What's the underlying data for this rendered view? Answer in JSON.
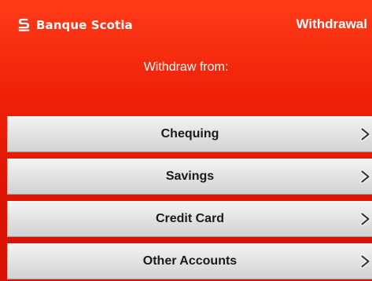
{
  "brand": {
    "name": "Banque Scotia",
    "logo_icon": "scotia-s-logo-icon"
  },
  "screen": {
    "title": "Withdrawal",
    "prompt": "Withdraw from:"
  },
  "options": [
    {
      "label": "Chequing",
      "icon": "chevron-right-icon"
    },
    {
      "label": "Savings",
      "icon": "chevron-right-icon"
    },
    {
      "label": "Credit Card",
      "icon": "chevron-right-icon"
    },
    {
      "label": "Other Accounts",
      "icon": "chevron-right-icon"
    }
  ],
  "colors": {
    "background_red": "#e41b04",
    "button_gray": "#e0e0e0",
    "text_white": "#ffffff",
    "text_dark": "#1a1a1a"
  }
}
